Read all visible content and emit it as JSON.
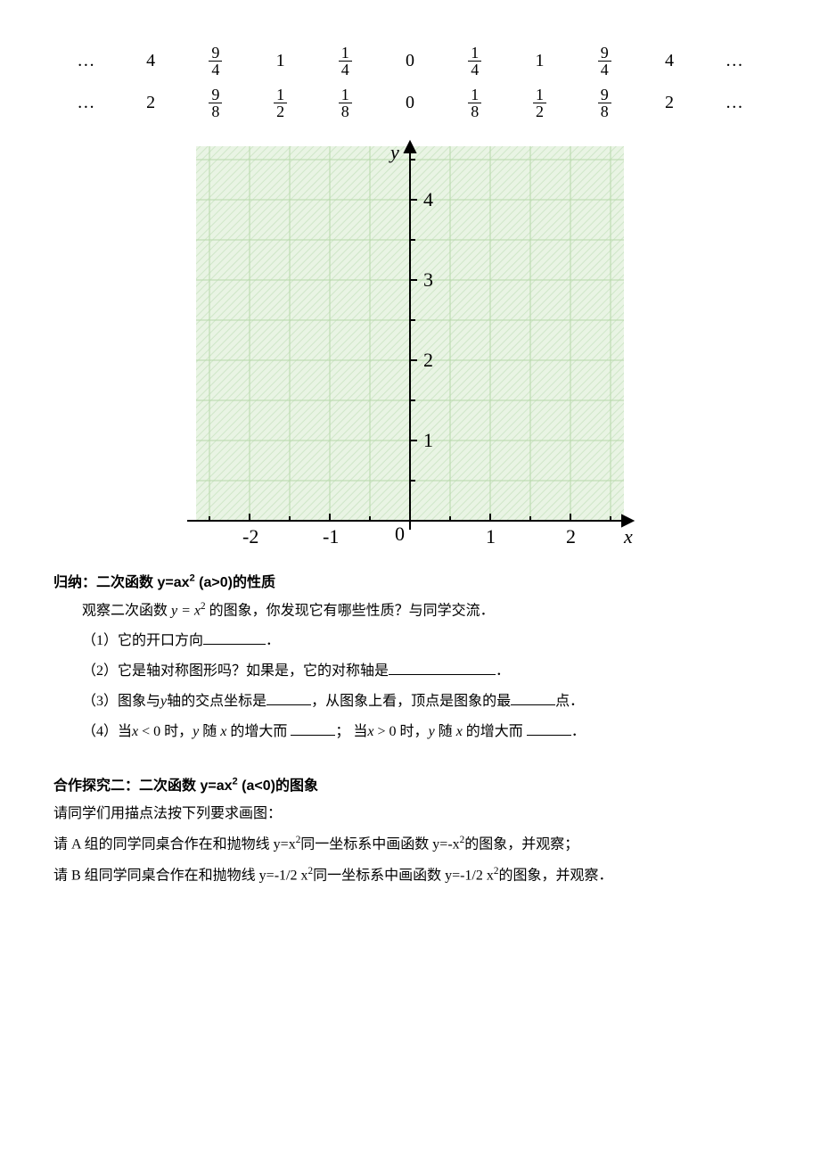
{
  "table": {
    "row1": [
      "…",
      "4",
      "9/4",
      "1",
      "1/4",
      "0",
      "1/4",
      "1",
      "9/4",
      "4",
      "…"
    ],
    "row2": [
      "…",
      "2",
      "9/8",
      "1/2",
      "1/8",
      "0",
      "1/8",
      "1/2",
      "9/8",
      "2",
      "…"
    ]
  },
  "chart_data": {
    "type": "line",
    "title": "",
    "xlabel": "x",
    "ylabel": "y",
    "xlim": [
      -2.5,
      2.5
    ],
    "ylim": [
      0,
      4.5
    ],
    "xticks": [
      -2,
      -1,
      0,
      1,
      2
    ],
    "yticks": [
      1,
      2,
      3,
      4
    ],
    "grid": true,
    "series": []
  },
  "section1": {
    "title_prefix": "归纳：二次函数 y=ax",
    "title_suffix": " (a>0)的性质",
    "intro_a": "观察二次函数 ",
    "intro_b": "y = x",
    "intro_c": " 的图象，你发现它有哪些性质？与同学交流．",
    "q1": "（1）它的开口方向",
    "q1_end": "．",
    "q2_a": "（2）它是轴对称图形吗？如果是，它的对称轴是",
    "q2_end": "．",
    "q3_a": "（3）图象与",
    "q3_y": "y",
    "q3_b": "轴的交点坐标是",
    "q3_c": "，从图象上看，顶点是图象的最",
    "q3_end": "点．",
    "q4_a": "（4）当",
    "q4_x1": "x",
    "q4_b": " < 0 时，",
    "q4_y1": "y",
    "q4_c": " 随 ",
    "q4_x2": "x",
    "q4_d": " 的增大而 ",
    "q4_e": "； 当",
    "q4_x3": "x",
    "q4_f": " > 0 时，",
    "q4_y2": "y",
    "q4_g": " 随 ",
    "q4_x4": "x",
    "q4_h": " 的增大而 ",
    "q4_end": "．"
  },
  "section2": {
    "title_prefix": "合作探究二：二次函数 y=ax",
    "title_suffix": " (a<0)的图象",
    "line1": "请同学们用描点法按下列要求画图：",
    "line2_a": "请 A 组的同学同桌合作在和抛物线 y=x",
    "line2_b": "同一坐标系中画函数 y=-x",
    "line2_c": "的图象，并观察；",
    "line3_a": "请 B 组同学同桌合作在和抛物线 y=-1/2 x",
    "line3_b": "同一坐标系中画函数 y=-1/2 x",
    "line3_c": "的图象，并观察．"
  }
}
